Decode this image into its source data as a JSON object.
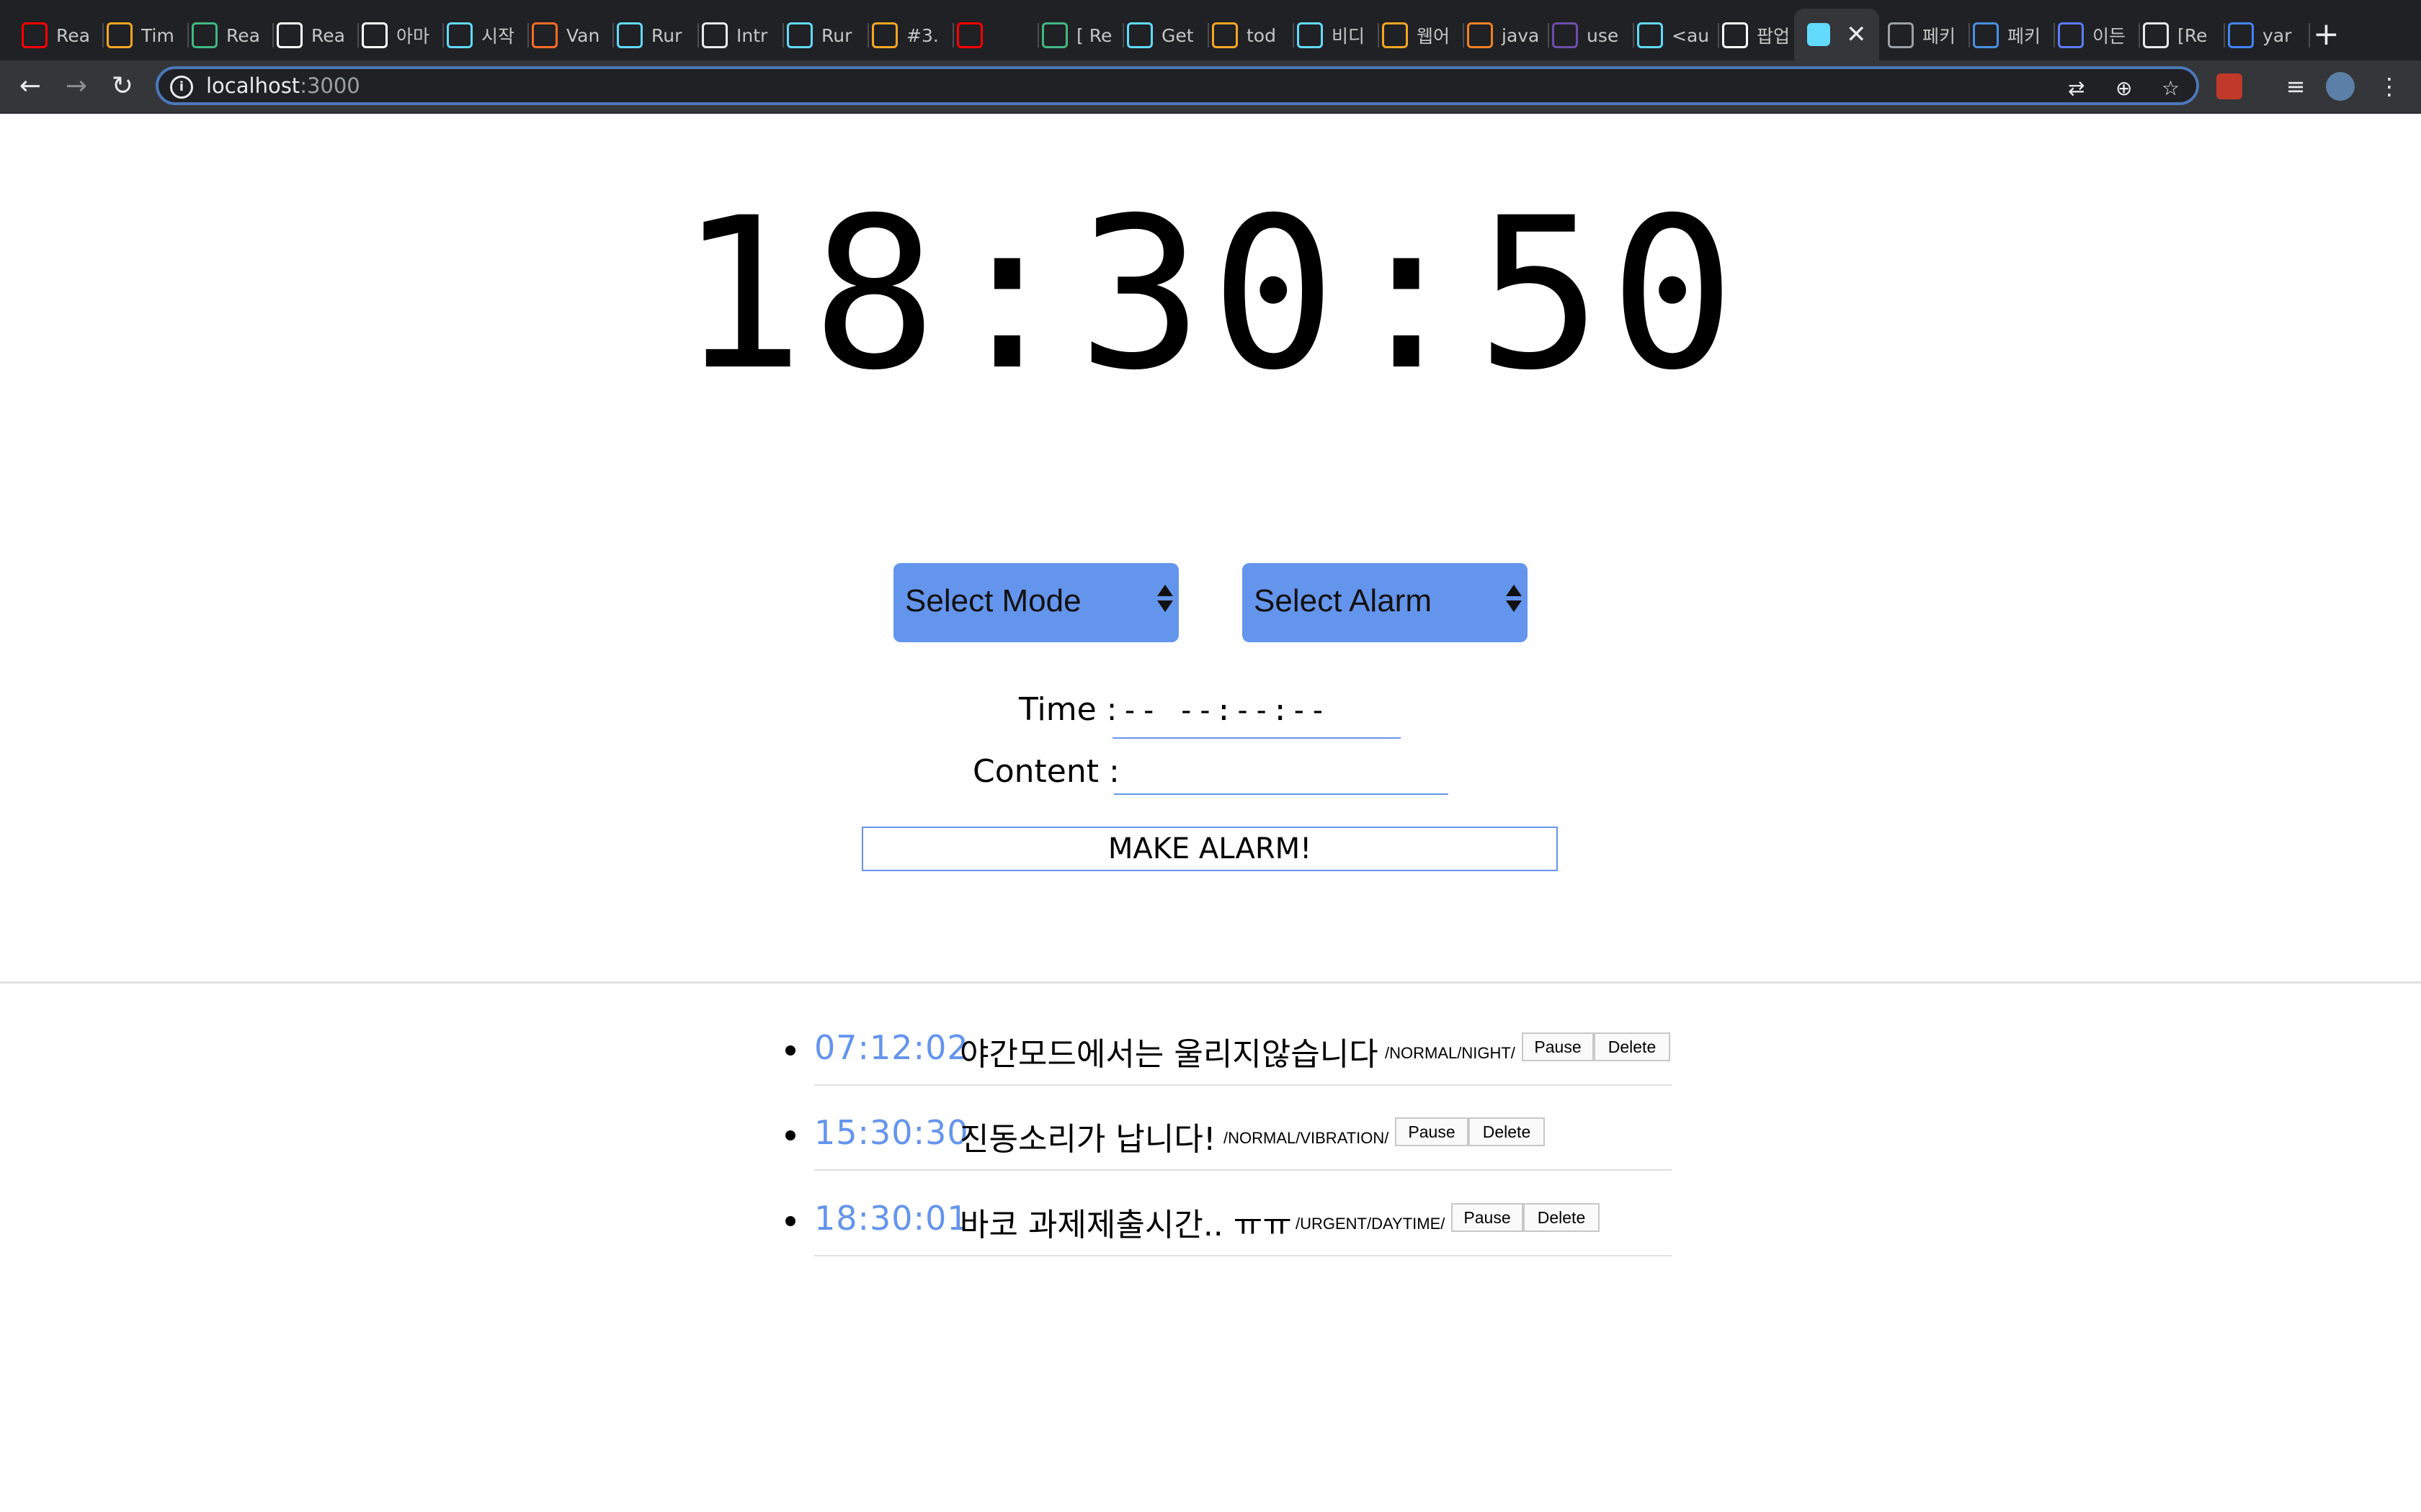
{
  "browser": {
    "tabs": [
      {
        "label": "Rea",
        "icon": "youtube-play-icon",
        "color": "#ff0000"
      },
      {
        "label": "Tim",
        "icon": "firebase-icon",
        "color": "#f5a623"
      },
      {
        "label": "Rea",
        "icon": "vue-icon",
        "color": "#41b883"
      },
      {
        "label": "Rea",
        "icon": "medium-icon",
        "color": "#ffffff"
      },
      {
        "label": "아마",
        "icon": "medium-icon",
        "color": "#ffffff"
      },
      {
        "label": "시작",
        "icon": "react-icon",
        "color": "#61dafb"
      },
      {
        "label": "Van",
        "icon": "gitlab-icon",
        "color": "#fc6d26"
      },
      {
        "label": "Rur",
        "icon": "react-icon",
        "color": "#61dafb"
      },
      {
        "label": "Intr",
        "icon": "book-icon",
        "color": "#e8eaed"
      },
      {
        "label": "Rur",
        "icon": "react-icon",
        "color": "#61dafb"
      },
      {
        "label": "#3.",
        "icon": "warning-icon",
        "color": "#f5a623"
      },
      {
        "label": "",
        "icon": "youtube-icon",
        "color": "#ff0000"
      },
      {
        "label": "[ Re",
        "icon": "vue-icon",
        "color": "#41b883"
      },
      {
        "label": "Get",
        "icon": "react-icon",
        "color": "#61dafb"
      },
      {
        "label": "tod",
        "icon": "firebase-icon",
        "color": "#f5a623"
      },
      {
        "label": "비디",
        "icon": "gitbook-icon",
        "color": "#61dafb"
      },
      {
        "label": "웹어",
        "icon": "firebase-icon",
        "color": "#f5a623"
      },
      {
        "label": "java",
        "icon": "stackoverflow-icon",
        "color": "#f48024"
      },
      {
        "label": "use",
        "icon": "bit-icon",
        "color": "#6e4dad"
      },
      {
        "label": "<au",
        "icon": "gitbook-icon",
        "color": "#61dafb"
      },
      {
        "label": "팝업",
        "icon": "medium-icon",
        "color": "#ffffff"
      }
    ],
    "tabs_right": [
      {
        "label": "페키",
        "icon": "globe-icon",
        "color": "#9aa0a6"
      },
      {
        "label": "페키",
        "icon": "bird-icon",
        "color": "#4a90e2"
      },
      {
        "label": "이든",
        "icon": "shield-icon",
        "color": "#5b7cfa"
      },
      {
        "label": "[Re",
        "icon": "owl-icon",
        "color": "#e8eaed"
      },
      {
        "label": "yar",
        "icon": "google-icon",
        "color": "#4285f4"
      }
    ],
    "active_tab_icon": "react-icon",
    "url_host": "localhost",
    "url_port": ":3000"
  },
  "clock": {
    "time": "18:30:50"
  },
  "form": {
    "mode_select": "Select Mode",
    "alarm_select": "Select Alarm",
    "time_label": "Time :",
    "time_value": "--  --:--:--",
    "content_label": "Content :",
    "content_value": "",
    "submit_label": "MAKE ALARM!"
  },
  "alarms": [
    {
      "time": "07:12:02",
      "content": "야간모드에서는 울리지않습니다",
      "meta": "/NORMAL/NIGHT/",
      "pause": "Pause",
      "delete": "Delete"
    },
    {
      "time": "15:30:30",
      "content": "진동소리가 납니다!",
      "meta": "/NORMAL/VIBRATION/",
      "pause": "Pause",
      "delete": "Delete"
    },
    {
      "time": "18:30:01",
      "content": "바코 과제제출시간.. ㅠㅠ",
      "meta": "/URGENT/DAYTIME/",
      "pause": "Pause",
      "delete": "Delete"
    }
  ],
  "colors": {
    "accent": "#6495ed",
    "chrome_dark": "#202124",
    "chrome_toolbar": "#35363a"
  }
}
